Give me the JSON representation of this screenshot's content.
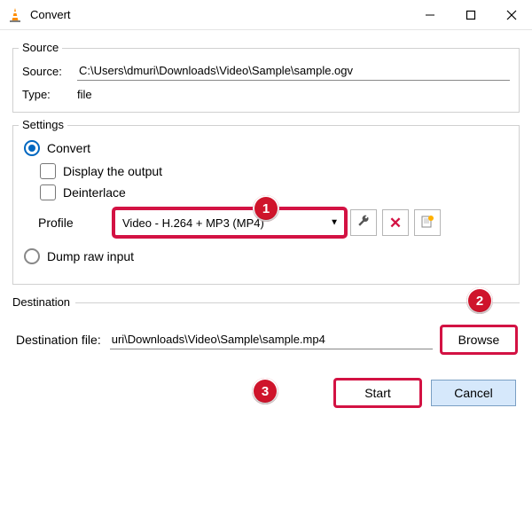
{
  "window": {
    "title": "Convert"
  },
  "source_group": {
    "legend": "Source",
    "source_label": "Source:",
    "source_value": "C:\\Users\\dmuri\\Downloads\\Video\\Sample\\sample.ogv",
    "type_label": "Type:",
    "type_value": "file"
  },
  "settings_group": {
    "legend": "Settings",
    "convert_label": "Convert",
    "display_output_label": "Display the output",
    "deinterlace_label": "Deinterlace",
    "profile_label": "Profile",
    "profile_value": "Video - H.264 + MP3 (MP4)",
    "dump_raw_label": "Dump raw input"
  },
  "destination_group": {
    "legend": "Destination",
    "dest_label": "Destination file:",
    "dest_value": "uri\\Downloads\\Video\\Sample\\sample.mp4",
    "browse_label": "Browse"
  },
  "buttons": {
    "start": "Start",
    "cancel": "Cancel"
  },
  "annotations": {
    "b1": "1",
    "b2": "2",
    "b3": "3"
  },
  "icons": {
    "wrench": "wrench-icon",
    "delete": "delete-icon",
    "new": "new-profile-icon"
  }
}
